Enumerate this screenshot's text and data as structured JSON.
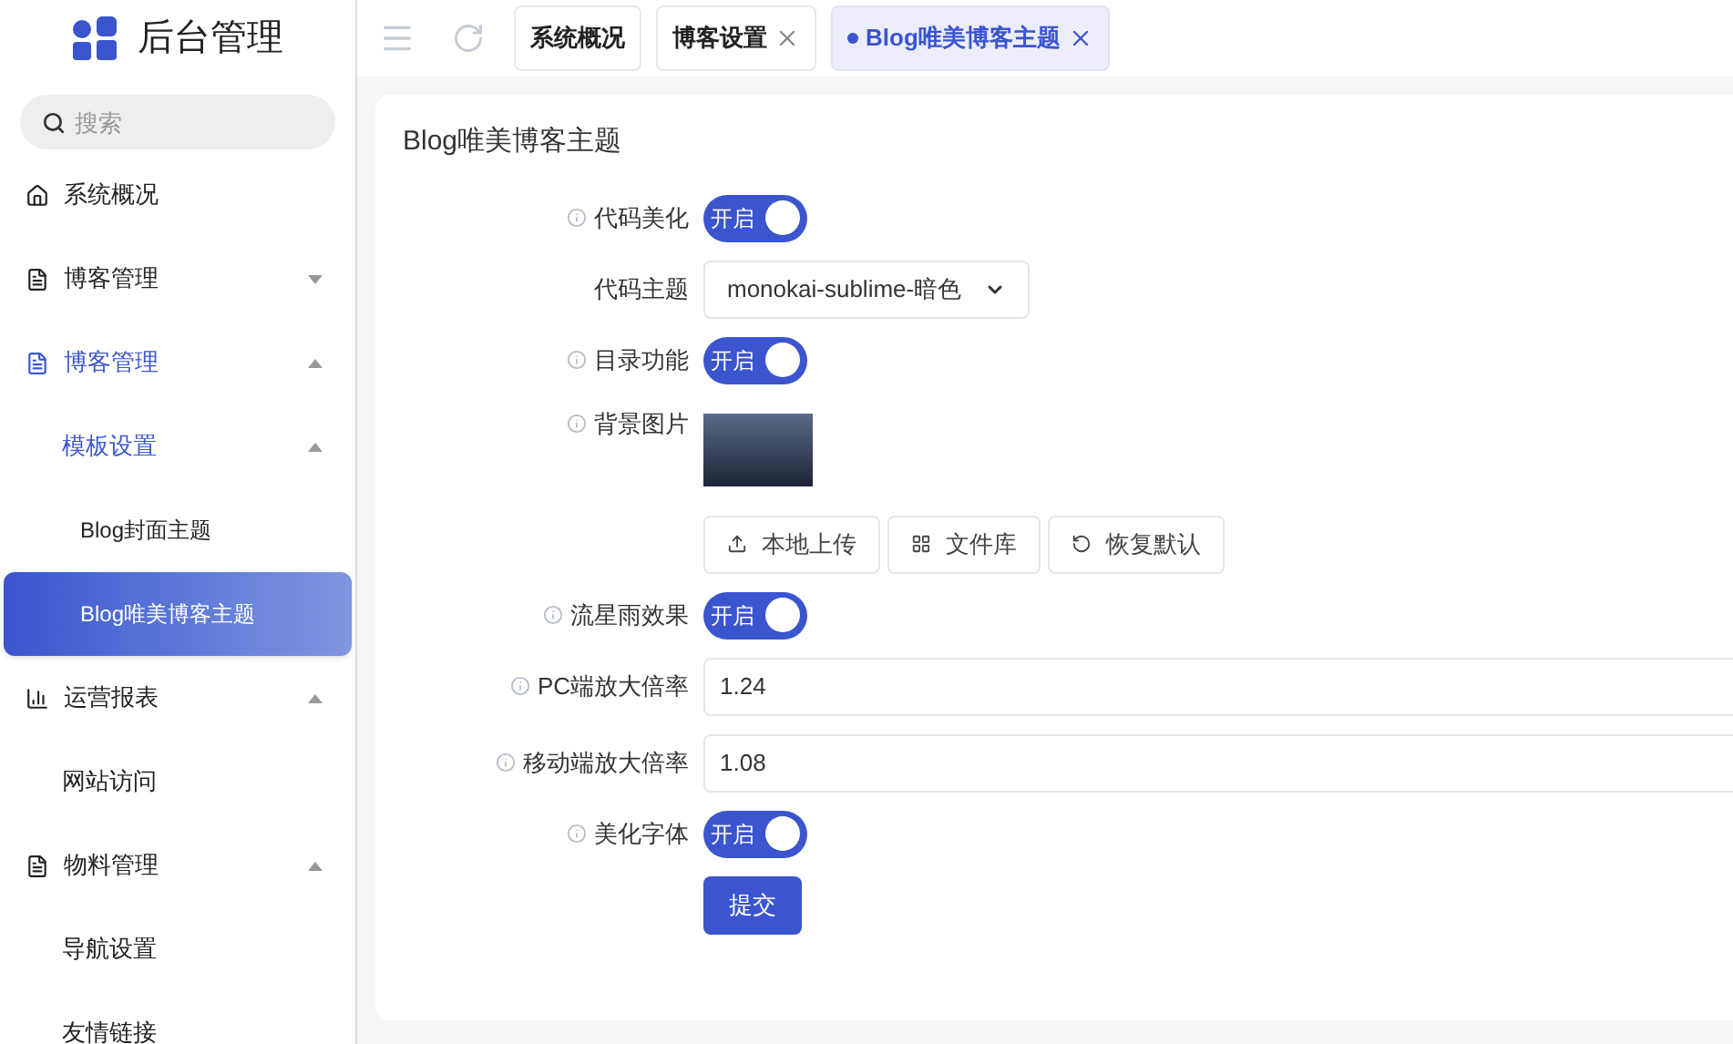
{
  "logo": {
    "title": "后台管理"
  },
  "search": {
    "placeholder": "搜索"
  },
  "sidebar": {
    "items": [
      {
        "label": "系统概况",
        "selected": false
      },
      {
        "label": "博客管理",
        "expanded": false,
        "selected": false
      },
      {
        "label": "博客管理",
        "expanded": true,
        "selected": false,
        "children": [
          {
            "label": "模板设置",
            "expanded": true,
            "selected": false,
            "children": [
              {
                "label": "Blog封面主题",
                "selected": false
              },
              {
                "label": "Blog唯美博客主题",
                "selected": true
              }
            ]
          }
        ]
      },
      {
        "label": "运营报表",
        "expanded": true,
        "selected": false,
        "children": [
          {
            "label": "网站访问",
            "selected": false
          }
        ]
      },
      {
        "label": "物料管理",
        "expanded": true,
        "selected": false,
        "children": [
          {
            "label": "导航设置",
            "selected": false
          },
          {
            "label": "友情链接",
            "selected": false
          }
        ]
      }
    ]
  },
  "tabs": [
    {
      "label": "系统概况",
      "closable": false,
      "selected": false
    },
    {
      "label": "博客设置",
      "closable": true,
      "selected": false
    },
    {
      "label": "Blog唯美博客主题",
      "closable": true,
      "selected": true
    }
  ],
  "panel": {
    "title": "Blog唯美博客主题",
    "fields": [
      {
        "kind": "switch",
        "label": "代码美化",
        "hint": true,
        "on": true,
        "text": "开启"
      },
      {
        "kind": "select",
        "label": "代码主题",
        "hint": false,
        "value": "monokai-sublime-暗色"
      },
      {
        "kind": "switch",
        "label": "目录功能",
        "hint": true,
        "on": true,
        "text": "开启"
      },
      {
        "kind": "image",
        "label": "背景图片",
        "hint": true,
        "buttons": [
          {
            "label": "本地上传"
          },
          {
            "label": "文件库"
          },
          {
            "label": "恢复默认"
          }
        ]
      },
      {
        "kind": "switch",
        "label": "流星雨效果",
        "hint": true,
        "on": true,
        "text": "开启"
      },
      {
        "kind": "input",
        "label": "PC端放大倍率",
        "hint": true,
        "value": "1.24"
      },
      {
        "kind": "input",
        "label": "移动端放大倍率",
        "hint": true,
        "value": "1.08"
      },
      {
        "kind": "switch",
        "label": "美化字体",
        "hint": true,
        "on": true,
        "text": "开启"
      }
    ],
    "submit": "提交"
  }
}
